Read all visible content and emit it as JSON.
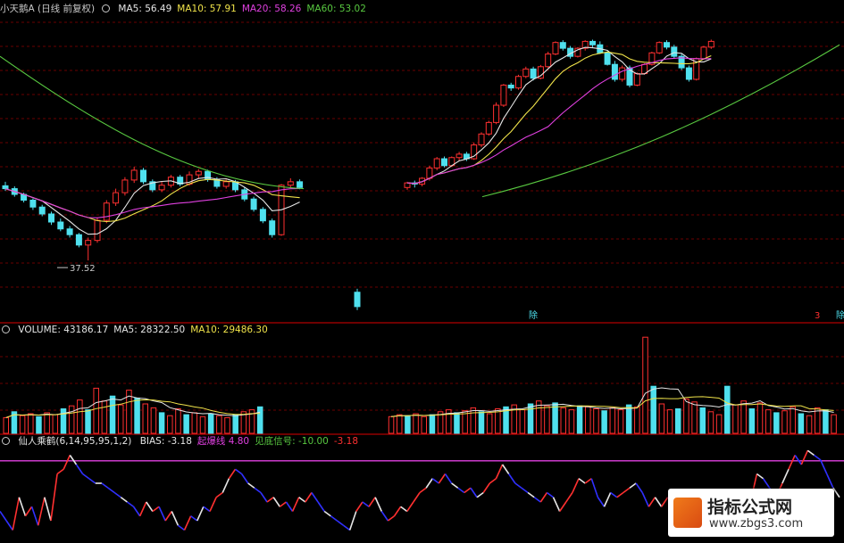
{
  "main_panel": {
    "title": "小天鹅A (日线 前复权)",
    "indicators": [
      {
        "label": "MA5:",
        "value": "56.49",
        "color": "#e6e6e6"
      },
      {
        "label": "MA10:",
        "value": "57.91",
        "color": "#f0e34a"
      },
      {
        "label": "MA20:",
        "value": "58.26",
        "color": "#e040e0"
      },
      {
        "label": "MA60:",
        "value": "53.02",
        "color": "#58c840"
      }
    ],
    "low_label": "37.52",
    "markers": [
      "除",
      "3",
      "除"
    ]
  },
  "volume_panel": {
    "indicators": [
      {
        "label": "VOLUME:",
        "value": "43186.17",
        "color": "#e6e6e6"
      },
      {
        "label": "MA5:",
        "value": "28322.50",
        "color": "#e6e6e6"
      },
      {
        "label": "MA10:",
        "value": "29486.30",
        "color": "#f0e34a"
      }
    ]
  },
  "indicator_panel": {
    "indicators": [
      {
        "label": "仙人乘鹤(6,14,95,95,1,2)",
        "value": "",
        "color": "#e6e6e6"
      },
      {
        "label": "BIAS:",
        "value": "-3.18",
        "color": "#e6e6e6"
      },
      {
        "label": "起爆线",
        "value": "4.80",
        "color": "#e040e0"
      },
      {
        "label": "见底信号:",
        "value": "-10.00",
        "color": "#58c840"
      },
      {
        "label": "",
        "value": "-3.18",
        "color": "#ff3030"
      }
    ]
  },
  "watermark": {
    "title": "指标公式网",
    "url": "www.zbgs3.com"
  },
  "colors": {
    "up": "#ff3030",
    "down": "#4fe0ee",
    "ma5": "#e6e6e6",
    "ma10": "#f0e34a",
    "ma20": "#e040e0",
    "ma60": "#58c840",
    "grid": "#6a0000",
    "border": "#b00000",
    "bias_up": "#ff3030",
    "bias_down": "#3030ff",
    "bias_flat": "#e6e6e6"
  },
  "chart_data": [
    {
      "type": "candlestick",
      "title": "小天鹅A (日线 前复权)",
      "series_names": [
        "MA5",
        "MA10",
        "MA20",
        "MA60"
      ],
      "annotation": "37.52",
      "segments": [
        {
          "name": "segment-1",
          "ohlc": [
            [
              50.5,
              51.2,
              49.6,
              50.0
            ],
            [
              50.0,
              50.4,
              48.6,
              49.0
            ],
            [
              49.0,
              49.3,
              47.6,
              48.0
            ],
            [
              48.0,
              48.3,
              46.3,
              46.8
            ],
            [
              46.8,
              47.2,
              45.2,
              45.6
            ],
            [
              45.6,
              46.0,
              43.7,
              44.2
            ],
            [
              44.2,
              44.8,
              42.6,
              43.0
            ],
            [
              43.0,
              43.5,
              41.5,
              42.0
            ],
            [
              42.0,
              42.3,
              39.8,
              40.2
            ],
            [
              40.2,
              41.5,
              37.52,
              41.0
            ],
            [
              41.0,
              45.0,
              40.6,
              44.5
            ],
            [
              44.5,
              48.0,
              44.0,
              47.5
            ],
            [
              47.5,
              50.0,
              47.0,
              49.3
            ],
            [
              49.3,
              52.0,
              48.8,
              51.5
            ],
            [
              51.5,
              53.8,
              51.0,
              53.2
            ],
            [
              53.2,
              53.6,
              50.8,
              51.2
            ],
            [
              51.2,
              51.6,
              49.4,
              49.8
            ],
            [
              49.8,
              51.2,
              49.4,
              50.6
            ],
            [
              50.6,
              52.4,
              50.2,
              52.0
            ],
            [
              52.0,
              52.4,
              50.4,
              50.8
            ],
            [
              50.8,
              53.0,
              50.5,
              52.4
            ],
            [
              52.4,
              53.4,
              51.8,
              53.0
            ],
            [
              53.0,
              53.3,
              51.2,
              51.6
            ],
            [
              51.6,
              52.0,
              50.0,
              50.4
            ],
            [
              50.4,
              51.6,
              50.0,
              51.2
            ],
            [
              51.2,
              51.5,
              49.4,
              49.8
            ],
            [
              49.8,
              50.3,
              47.8,
              48.2
            ],
            [
              48.2,
              48.6,
              46.0,
              46.4
            ],
            [
              46.4,
              46.8,
              44.0,
              44.4
            ],
            [
              44.4,
              44.8,
              41.5,
              42.0
            ],
            [
              42.0,
              50.8,
              41.8,
              50.6
            ],
            [
              50.6,
              51.8,
              50.2,
              51.2
            ],
            [
              51.2,
              51.6,
              49.9,
              50.2
            ]
          ]
        },
        {
          "name": "segment-2",
          "ohlc": [
            [
              32.0,
              32.6,
              28.9,
              29.5
            ]
          ]
        },
        {
          "name": "segment-3",
          "ohlc": [
            [
              50.2,
              51.2,
              49.8,
              51.0
            ],
            [
              51.0,
              51.4,
              50.2,
              50.8
            ],
            [
              50.8,
              52.0,
              50.4,
              51.8
            ],
            [
              51.8,
              54.0,
              51.4,
              53.6
            ],
            [
              53.6,
              55.5,
              53.2,
              55.2
            ],
            [
              55.2,
              55.6,
              53.7,
              54.0
            ],
            [
              54.0,
              55.6,
              53.8,
              55.4
            ],
            [
              55.4,
              56.4,
              54.8,
              56.0
            ],
            [
              56.0,
              56.4,
              54.8,
              55.2
            ],
            [
              55.2,
              58.0,
              55.0,
              57.6
            ],
            [
              57.6,
              59.8,
              57.2,
              59.5
            ],
            [
              59.5,
              61.8,
              59.2,
              61.5
            ],
            [
              61.5,
              65.0,
              61.2,
              64.5
            ],
            [
              64.5,
              68.2,
              64.2,
              68.0
            ],
            [
              68.0,
              68.4,
              67.0,
              67.5
            ],
            [
              67.5,
              69.8,
              67.2,
              69.5
            ],
            [
              69.5,
              71.2,
              69.2,
              70.8
            ],
            [
              70.8,
              71.2,
              68.8,
              69.2
            ],
            [
              69.2,
              71.5,
              69.0,
              71.2
            ],
            [
              71.2,
              73.8,
              71.0,
              73.4
            ],
            [
              73.4,
              75.6,
              73.2,
              75.4
            ],
            [
              75.4,
              75.8,
              74.0,
              74.4
            ],
            [
              74.4,
              74.8,
              72.6,
              73.0
            ],
            [
              73.0,
              74.6,
              72.8,
              74.4
            ],
            [
              74.4,
              75.8,
              74.0,
              75.6
            ],
            [
              75.6,
              75.9,
              74.6,
              75.0
            ],
            [
              75.0,
              75.6,
              73.4,
              73.6
            ],
            [
              73.6,
              73.9,
              71.4,
              71.6
            ],
            [
              71.6,
              72.2,
              68.6,
              69.0
            ],
            [
              69.0,
              71.4,
              68.6,
              71.0
            ],
            [
              71.0,
              71.4,
              67.6,
              68.0
            ],
            [
              68.0,
              70.2,
              67.8,
              70.0
            ],
            [
              70.0,
              71.8,
              69.8,
              71.6
            ],
            [
              71.6,
              73.8,
              71.4,
              73.6
            ],
            [
              73.6,
              75.6,
              73.4,
              75.4
            ],
            [
              75.4,
              75.8,
              74.2,
              74.6
            ],
            [
              74.6,
              75.0,
              72.6,
              73.0
            ],
            [
              73.0,
              73.4,
              70.6,
              71.0
            ],
            [
              71.0,
              71.4,
              68.6,
              69.0
            ],
            [
              69.0,
              72.8,
              68.8,
              72.6
            ],
            [
              72.6,
              74.8,
              72.4,
              74.6
            ],
            [
              74.6,
              75.9,
              74.3,
              75.6
            ]
          ]
        }
      ],
      "ma60": [
        73.0,
        50.0,
        48.6,
        75.0
      ],
      "xlabel": "",
      "ylabel": ""
    },
    {
      "type": "bar",
      "title": "VOLUME",
      "series_names": [
        "VOLUME",
        "MA5",
        "MA10"
      ],
      "values": [
        16,
        22,
        18,
        20,
        17,
        21,
        19,
        25,
        28,
        34,
        24,
        46,
        33,
        38,
        29,
        44,
        36,
        30,
        26,
        21,
        18,
        25,
        19,
        21,
        17,
        20,
        18,
        16,
        19,
        22,
        24,
        27,
        0,
        0,
        0,
        0,
        0,
        0,
        0,
        0,
        0,
        0,
        0,
        0,
        0,
        0,
        0,
        17,
        19,
        18,
        20,
        17,
        19,
        22,
        24,
        21,
        23,
        26,
        22,
        20,
        25,
        27,
        29,
        24,
        30,
        33,
        28,
        31,
        26,
        24,
        28,
        27,
        25,
        23,
        26,
        24,
        29,
        27,
        98,
        48,
        30,
        24,
        25,
        35,
        32,
        26,
        22,
        19,
        48,
        29,
        33,
        25,
        31,
        24,
        21,
        23,
        27,
        20,
        18,
        26,
        24,
        19
      ]
    },
    {
      "type": "line",
      "title": "仙人乘鹤(6,14,95,95,1,2)",
      "series_names": [
        "BIAS",
        "起爆线",
        "见底信号"
      ],
      "values": [
        -6,
        -8,
        -10,
        -3,
        -7,
        -5,
        -9,
        -3,
        -8,
        2,
        3,
        6,
        4,
        2,
        1,
        0,
        0,
        -1,
        -2,
        -3,
        -4,
        -5,
        -7,
        -4,
        -6,
        -5,
        -8,
        -6,
        -9,
        -10,
        -7,
        -8,
        -5,
        -6,
        -3,
        -2,
        1,
        3,
        2,
        0,
        -1,
        -2,
        -4,
        -3,
        -5,
        -4,
        -6,
        -3,
        -4,
        -2,
        -4,
        -6,
        -7,
        -8,
        -9,
        -10,
        -6,
        -4,
        -5,
        -3,
        -6,
        -8,
        -7,
        -5,
        -6,
        -4,
        -2,
        -1,
        1,
        0,
        2,
        0,
        -1,
        -2,
        -1,
        -3,
        -2,
        0,
        1,
        4,
        2,
        0,
        -1,
        -2,
        -3,
        -4,
        -2,
        -3,
        -6,
        -4,
        -2,
        1,
        0,
        1,
        -3,
        -5,
        -2,
        -3,
        -2,
        -1,
        0,
        -2,
        -5,
        -3,
        -5,
        -3,
        -4,
        -4,
        -7,
        -5,
        -6,
        -8,
        -7,
        -6,
        -8,
        -7,
        -6,
        -5,
        -4,
        2,
        1,
        -1,
        -3,
        0,
        3,
        6,
        4,
        7,
        6,
        5,
        2,
        -1,
        -3
      ],
      "hlines": [
        4.8,
        -10.0
      ]
    }
  ]
}
